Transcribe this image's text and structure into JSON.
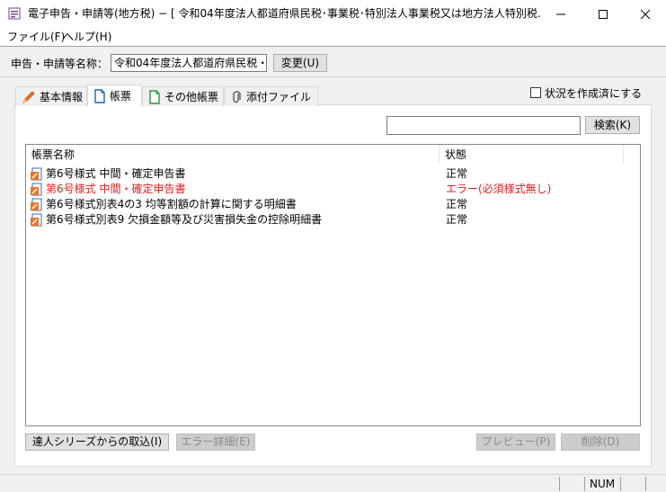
{
  "window": {
    "title": "電子申告・申請等(地方税) − [ 令和04年度法人都道府県民税･事業税･特別法人事業税又は地方法人特別税…"
  },
  "menu": [
    {
      "label": "ファイル(F)"
    },
    {
      "label": "ヘルプ(H)"
    }
  ],
  "toolbar": {
    "name_label": "申告・申請等名称：",
    "name_value": "令和04年度法人都道府県民税・",
    "change_button": "変更(U)"
  },
  "tabs": [
    {
      "label": "基本情報",
      "icon": "pencil-icon"
    },
    {
      "label": "帳票",
      "icon": "document-icon"
    },
    {
      "label": "その他帳票",
      "icon": "document-green-icon"
    },
    {
      "label": "添付ファイル",
      "icon": "paperclip-icon"
    }
  ],
  "active_tab": "帳票",
  "checkbox": {
    "label": "状況を作成済にする",
    "checked": false
  },
  "search": {
    "value": "",
    "button": "検索(K)"
  },
  "table": {
    "columns": [
      "帳票名称",
      "状態"
    ],
    "rows": [
      {
        "name": "第6号様式 中間・確定申告書",
        "status": "正常",
        "error": false
      },
      {
        "name": "第6号様式 中間・確定申告書",
        "status": "エラー(必須様式無し)",
        "error": true
      },
      {
        "name": "第6号様式別表4の3 均等割額の計算に関する明細書",
        "status": "正常",
        "error": false
      },
      {
        "name": "第6号様式別表9 欠損金額等及び災害損失金の控除明細書",
        "status": "正常",
        "error": false
      }
    ]
  },
  "buttons": {
    "import": "達人シリーズからの取込(I)",
    "error_detail": "エラー詳細(E)",
    "preview": "プレビュー(P)",
    "delete": "削除(D)"
  },
  "statusbar": {
    "num": "NUM"
  },
  "colors": {
    "error": "#e02020",
    "selection_border": "#828790"
  }
}
